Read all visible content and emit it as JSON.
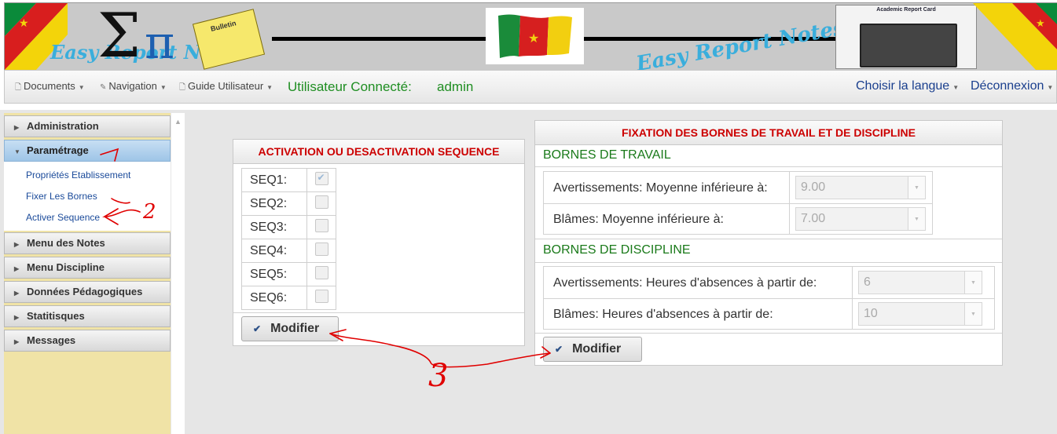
{
  "banner": {
    "logo_text_left": "Easy Report Notes",
    "logo_text_right": "Easy Report Notes",
    "bulletin_label": "Bulletin",
    "report_card_title": "Academic Report Card"
  },
  "navbar": {
    "documents": "Documents",
    "navigation": "Navigation",
    "guide": "Guide Utilisateur",
    "user_label": "Utilisateur Connecté:",
    "user_name": "admin",
    "language": "Choisir la langue",
    "logout": "Déconnexion"
  },
  "sidebar": {
    "administration": "Administration",
    "parametrage": "Paramétrage",
    "sub_items": [
      "Propriétés Etablissement",
      "Fixer Les Bornes",
      "Activer Sequence"
    ],
    "menu_notes": "Menu des Notes",
    "menu_discipline": "Menu Discipline",
    "donnees": "Données Pédagogiques",
    "statistiques": "Statitisques",
    "messages": "Messages"
  },
  "sequence_panel": {
    "title": "ACTIVATION OU DESACTIVATION SEQUENCE",
    "rows": [
      {
        "label": "SEQ1:",
        "checked": true
      },
      {
        "label": "SEQ2:",
        "checked": false
      },
      {
        "label": "SEQ3:",
        "checked": false
      },
      {
        "label": "SEQ4:",
        "checked": false
      },
      {
        "label": "SEQ5:",
        "checked": false
      },
      {
        "label": "SEQ6:",
        "checked": false
      }
    ],
    "button_label": "Modifier"
  },
  "bornes_panel": {
    "title": "FIXATION DES BORNES DE TRAVAIL ET DE DISCIPLINE",
    "travail_heading": "BORNES DE TRAVAIL",
    "travail_avert_label": "Avertissements: Moyenne inférieure à:",
    "travail_avert_value": "9.00",
    "travail_blame_label": "Blâmes: Moyenne inférieure à:",
    "travail_blame_value": "7.00",
    "discipline_heading": "BORNES DE DISCIPLINE",
    "discipline_avert_label": "Avertissements: Heures d'absences à partir de:",
    "discipline_avert_value": "6",
    "discipline_blame_label": "Blâmes: Heures d'absences à partir de:",
    "discipline_blame_value": "10",
    "button_label": "Modifier"
  },
  "annotations": {
    "mark_1": "1",
    "mark_2": "2",
    "mark_3": "3",
    "color": "#e00000"
  }
}
